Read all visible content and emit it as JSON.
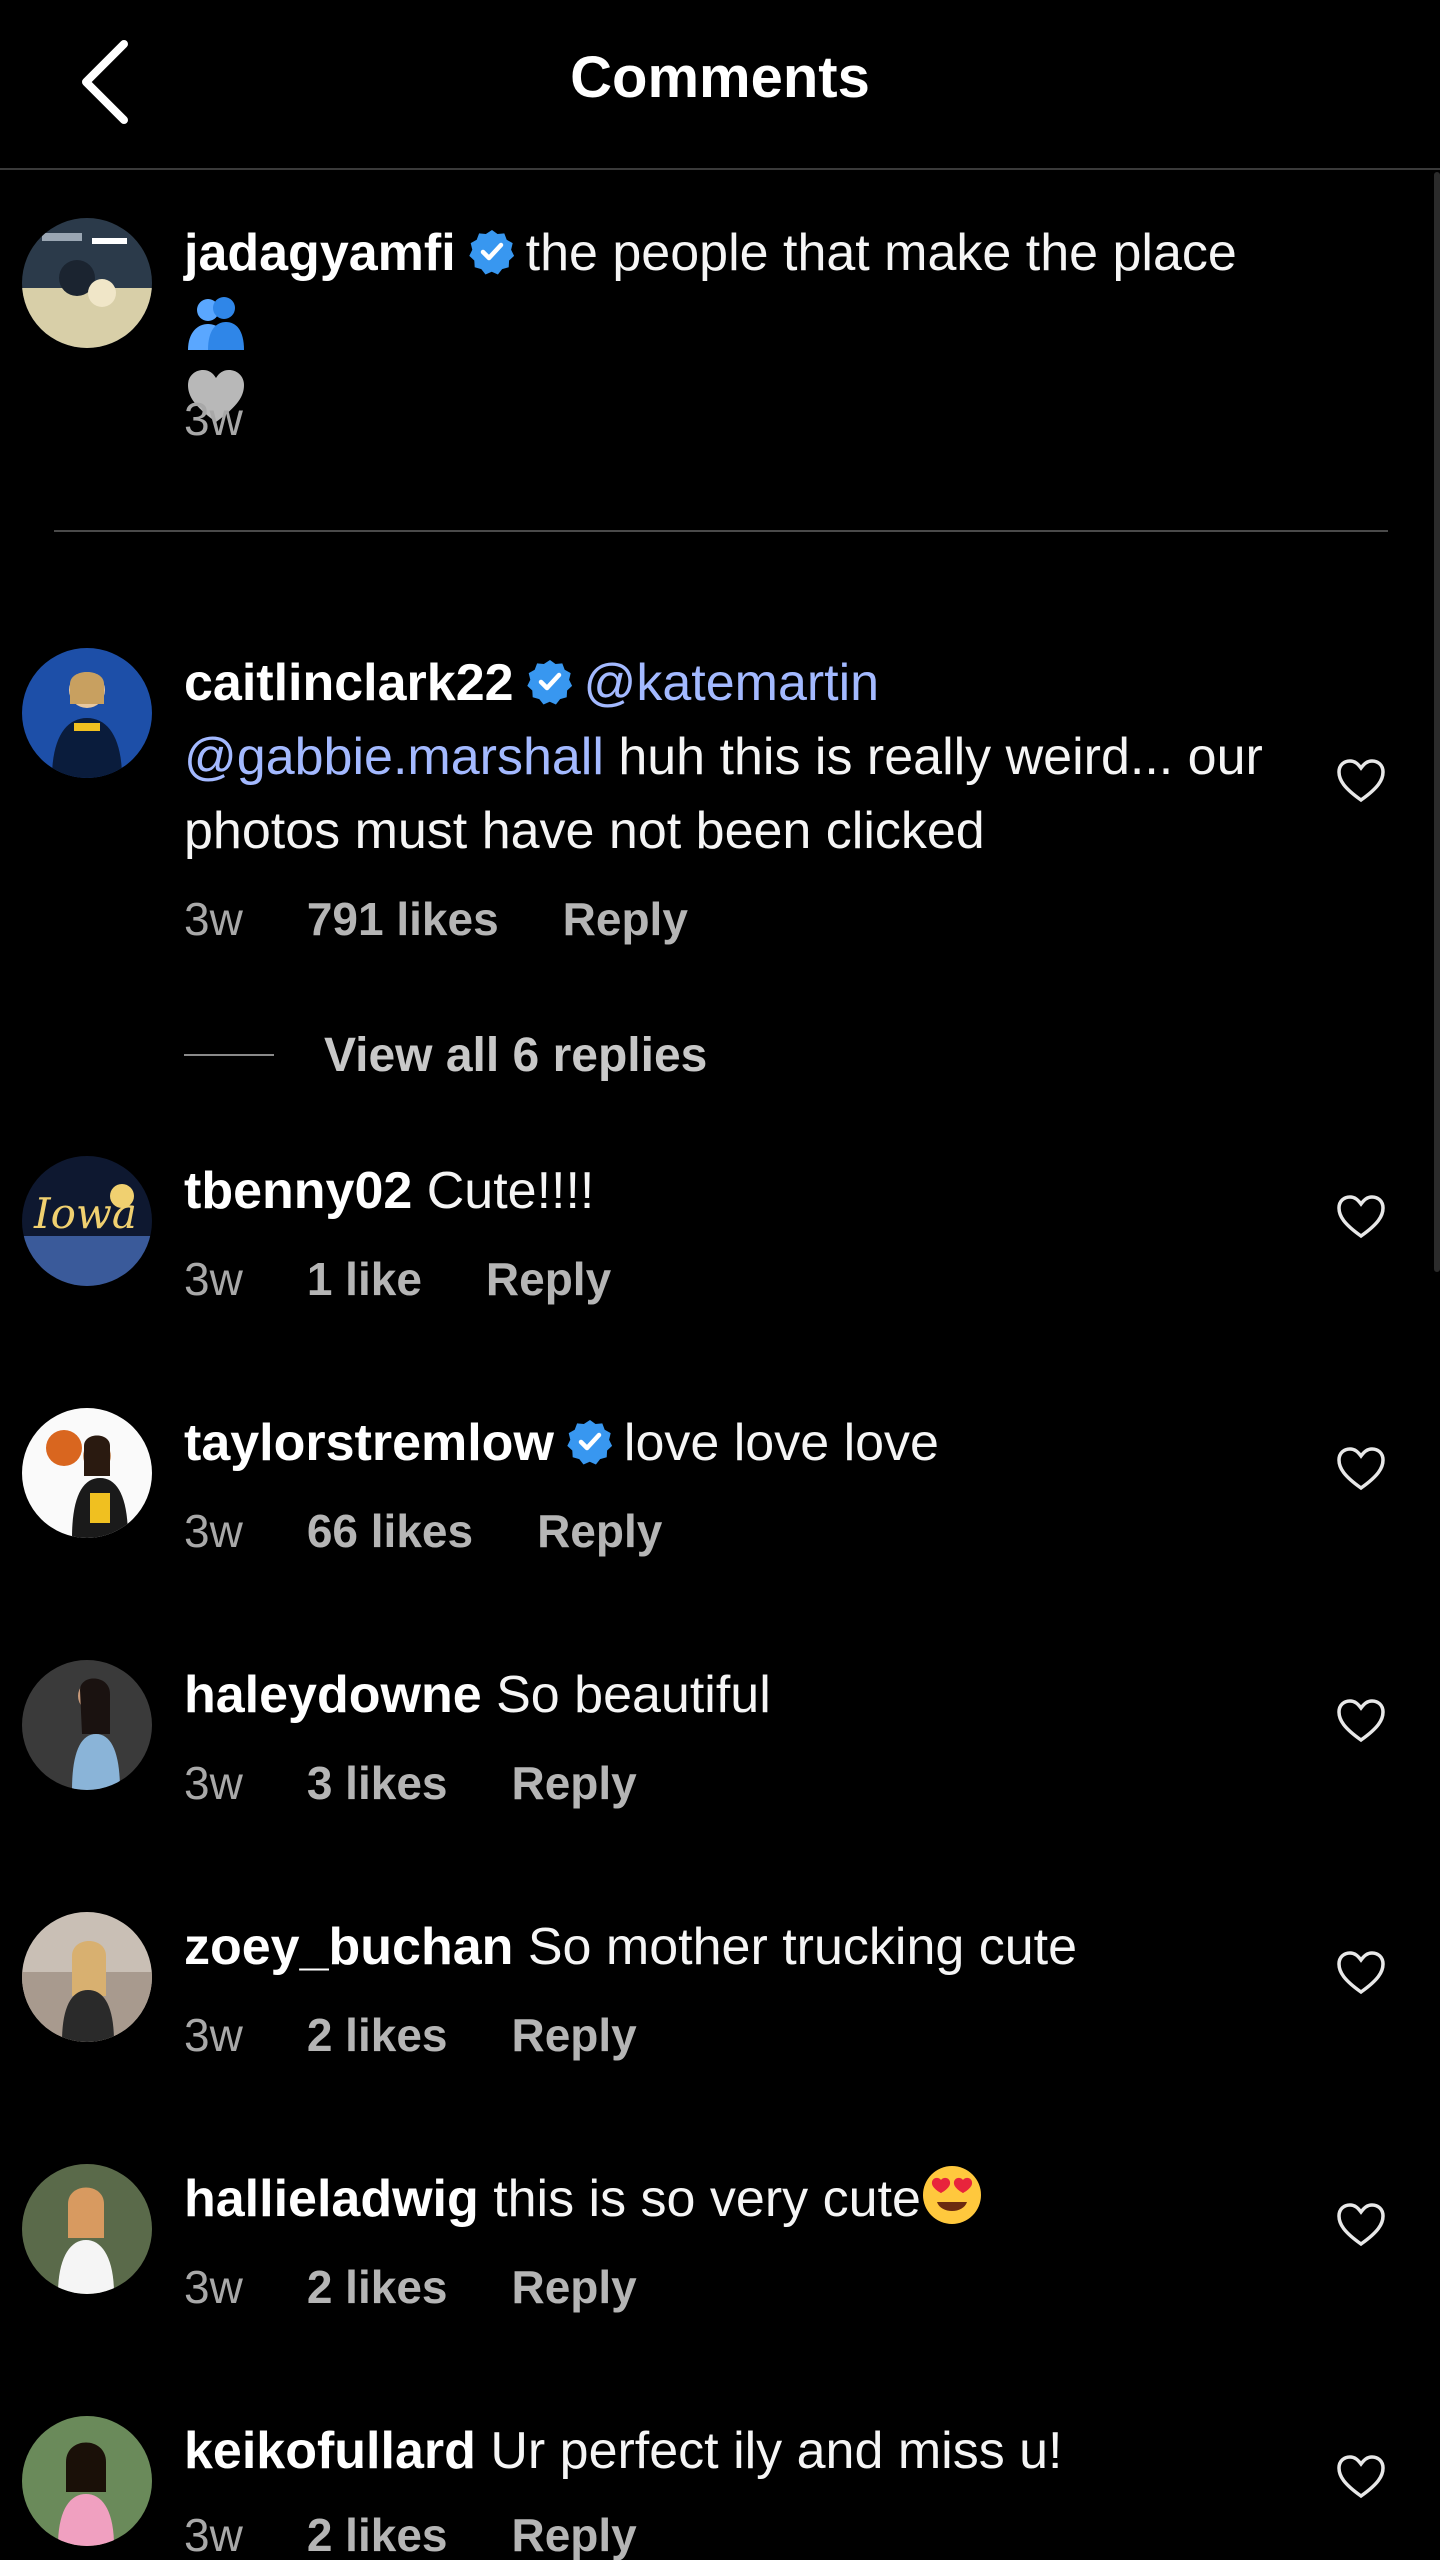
{
  "header": {
    "title": "Comments",
    "back_icon": "back-arrow-icon"
  },
  "comments": [
    {
      "username": "jadagyamfi",
      "verified": true,
      "text": "the people that make the place",
      "time": "3w"
    },
    {
      "username": "caitlinclark22",
      "verified": true,
      "mention1": "@katemartin",
      "mention2": "@gabbie.marshall",
      "text": " huh this is really weird... our photos must have not been clicked",
      "time": "3w",
      "likes": "791 likes",
      "reply": "Reply",
      "view_replies": "View all 6 replies"
    },
    {
      "username": "tbenny02",
      "verified": false,
      "text": "Cute!!!!",
      "time": "3w",
      "likes": "1 like",
      "reply": "Reply"
    },
    {
      "username": "taylorstremlow",
      "verified": true,
      "text": "love love love",
      "time": "3w",
      "likes": "66 likes",
      "reply": "Reply"
    },
    {
      "username": "haleydowne",
      "verified": false,
      "text": "So beautiful",
      "time": "3w",
      "likes": "3 likes",
      "reply": "Reply"
    },
    {
      "username": "zoey_buchan",
      "verified": false,
      "text": "So mother trucking cute",
      "time": "3w",
      "likes": "2 likes",
      "reply": "Reply"
    },
    {
      "username": "hallieladwig",
      "verified": false,
      "text": "this is so very cute",
      "time": "3w",
      "likes": "2 likes",
      "reply": "Reply"
    },
    {
      "username": "keikofullard",
      "verified": false,
      "text": "Ur perfect ily and miss u!",
      "time": "3w",
      "likes": "2 likes",
      "reply": "Reply"
    }
  ],
  "colors": {
    "background": "#000000",
    "verified": "#3897f0",
    "mention": "#a3b9ff",
    "meta": "#a8a8a8"
  }
}
